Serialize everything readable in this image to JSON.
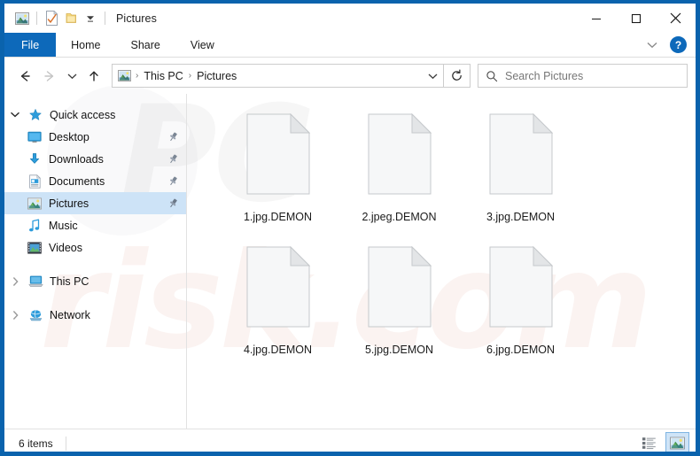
{
  "window": {
    "title": "Pictures",
    "quick_access_toolbar": [
      {
        "name": "pictures-folder-icon",
        "label": "Pictures"
      },
      {
        "name": "properties-icon",
        "label": "Properties"
      },
      {
        "name": "new-folder-icon",
        "label": "New folder"
      },
      {
        "name": "customize-qat-dropdown-icon",
        "label": "Customize Quick Access Toolbar"
      }
    ],
    "controls": {
      "minimize": "─",
      "maximize": "□",
      "close": "✕"
    }
  },
  "ribbon": {
    "tabs": [
      {
        "label": "File",
        "active": true
      },
      {
        "label": "Home",
        "active": false
      },
      {
        "label": "Share",
        "active": false
      },
      {
        "label": "View",
        "active": false
      }
    ],
    "expand_label": "⌄",
    "help_label": "?"
  },
  "navigation": {
    "back_label": "Back",
    "forward_label": "Forward",
    "recent_label": "Recent locations",
    "up_label": "Up",
    "refresh_label": "Refresh",
    "breadcrumb": [
      "This PC",
      "Pictures"
    ],
    "breadcrumb_separator": "›",
    "address_dropdown_label": "Previous locations"
  },
  "search": {
    "placeholder": "Search Pictures"
  },
  "sidebar": {
    "items": [
      {
        "label": "Quick access",
        "icon": "star-icon",
        "twisty": "expanded",
        "indent": 0,
        "pinned": false,
        "selected": false
      },
      {
        "label": "Desktop",
        "icon": "desktop-icon",
        "twisty": "none",
        "indent": 1,
        "pinned": true,
        "selected": false
      },
      {
        "label": "Downloads",
        "icon": "downloads-icon",
        "twisty": "none",
        "indent": 1,
        "pinned": true,
        "selected": false
      },
      {
        "label": "Documents",
        "icon": "documents-icon",
        "twisty": "none",
        "indent": 1,
        "pinned": true,
        "selected": false
      },
      {
        "label": "Pictures",
        "icon": "pictures-icon",
        "twisty": "none",
        "indent": 1,
        "pinned": true,
        "selected": true
      },
      {
        "label": "Music",
        "icon": "music-icon",
        "twisty": "none",
        "indent": 1,
        "pinned": false,
        "selected": false
      },
      {
        "label": "Videos",
        "icon": "videos-icon",
        "twisty": "none",
        "indent": 1,
        "pinned": false,
        "selected": false
      },
      {
        "label": "This PC",
        "icon": "this-pc-icon",
        "twisty": "collapsed",
        "indent": 0,
        "pinned": false,
        "selected": false,
        "gap": true
      },
      {
        "label": "Network",
        "icon": "network-icon",
        "twisty": "collapsed",
        "indent": 0,
        "pinned": false,
        "selected": false,
        "gap": true
      }
    ]
  },
  "files": [
    {
      "name": "1.jpg.DEMON",
      "icon": "blank-document-icon"
    },
    {
      "name": "2.jpeg.DEMON",
      "icon": "blank-document-icon"
    },
    {
      "name": "3.jpg.DEMON",
      "icon": "blank-document-icon"
    },
    {
      "name": "4.jpg.DEMON",
      "icon": "blank-document-icon"
    },
    {
      "name": "5.jpg.DEMON",
      "icon": "blank-document-icon"
    },
    {
      "name": "6.jpg.DEMON",
      "icon": "blank-document-icon"
    }
  ],
  "status": {
    "item_count": "6 items",
    "views": [
      {
        "name": "details-view-button",
        "label": "Details view",
        "active": false
      },
      {
        "name": "large-icons-view-button",
        "label": "Large icons view",
        "active": true
      }
    ]
  },
  "watermark": {
    "line1": "PC",
    "line2": "risk.com"
  },
  "colors": {
    "window_border": "#0a63ad",
    "accent": "#0d69ba",
    "selection": "#cde3f7",
    "close_hover": "#e81123"
  }
}
